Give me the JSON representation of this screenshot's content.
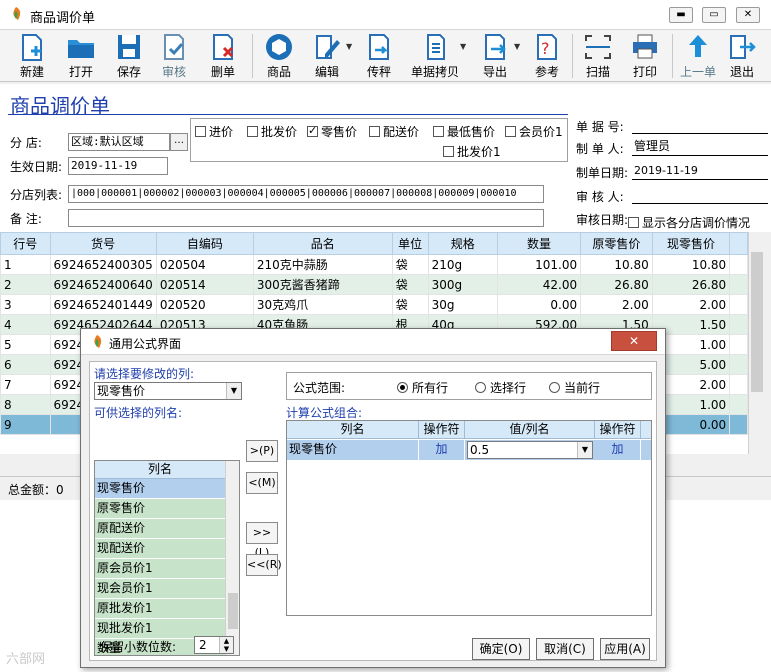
{
  "window": {
    "title": "商品调价单"
  },
  "toolbar": {
    "new": "新建",
    "open": "打开",
    "save": "保存",
    "audit": "审核",
    "delete": "删单",
    "product": "商品",
    "edit": "编辑",
    "transfer": "传秤",
    "copy": "单据拷贝",
    "export": "导出",
    "reference": "参考",
    "scan": "扫描",
    "print": "打印",
    "prev": "上一单",
    "exit": "退出"
  },
  "form": {
    "title": "商品调价单",
    "branch_label": "分      店:",
    "branch_value": "区域:默认区域",
    "effective_label": "生效日期:",
    "effective_value": "2019-11-19",
    "branch_list_label": "分店列表:",
    "branch_list_value": "|000|000001|000002|000003|000004|000005|000006|000007|000008|000009|000010",
    "remark_label": "备      注:",
    "remark_value": "",
    "checks": [
      {
        "label": "进价",
        "checked": false
      },
      {
        "label": "批发价",
        "checked": false
      },
      {
        "label": "零售价",
        "checked": true
      },
      {
        "label": "配送价",
        "checked": false
      },
      {
        "label": "最低售价",
        "checked": false
      },
      {
        "label": "会员价1",
        "checked": false
      },
      {
        "label": "批发价1",
        "checked": false
      }
    ],
    "doc_no_label": "单 据 号:",
    "doc_no_value": "",
    "maker_label": "制 单 人:",
    "maker_value": "管理员",
    "make_date_label": "制单日期:",
    "make_date_value": "2019-11-19",
    "auditor_label": "审 核 人:",
    "auditor_value": "",
    "audit_date_label": "审核日期:",
    "show_branch_label": "显示各分店调价情况"
  },
  "grid": {
    "headers": [
      "行号",
      "货号",
      "自编码",
      "品名",
      "单位",
      "规格",
      "数量",
      "原零售价",
      "现零售价"
    ],
    "rows": [
      [
        "1",
        "6924652400305",
        "020504",
        "210克中蒜肠",
        "袋",
        "210g",
        "101.00",
        "10.80",
        "10.80"
      ],
      [
        "2",
        "6924652400640",
        "020514",
        "300克酱香猪蹄",
        "袋",
        "300g",
        "42.00",
        "26.80",
        "26.80"
      ],
      [
        "3",
        "6924652401449",
        "020520",
        "30克鸡爪",
        "袋",
        "30g",
        "0.00",
        "2.00",
        "2.00"
      ],
      [
        "4",
        "6924652402644",
        "020513",
        "40克鱼肠",
        "根",
        "40g",
        "592.00",
        "1.50",
        "1.50"
      ],
      [
        "5",
        "6924",
        "",
        "",
        "",
        "",
        "",
        "",
        "1.00"
      ],
      [
        "6",
        "6924",
        "",
        "",
        "",
        "",
        "",
        "",
        "5.00"
      ],
      [
        "7",
        "6924",
        "",
        "",
        "",
        "",
        "",
        "",
        "2.00"
      ],
      [
        "8",
        "6924",
        "",
        "",
        "",
        "",
        "",
        "",
        "1.00"
      ],
      [
        "9",
        "",
        "",
        "",
        "",
        "",
        "",
        "",
        "0.00"
      ]
    ]
  },
  "status": {
    "total": "总金额：0"
  },
  "dialog": {
    "title": "通用公式界面",
    "select_col_label": "请选择要修改的列:",
    "select_col_value": "现零售价",
    "available_label": "可供选择的列名:",
    "list_header": "列名",
    "list_items": [
      "现零售价",
      "原零售价",
      "原配送价",
      "现配送价",
      "原会员价1",
      "现会员价1",
      "原批发价1",
      "现批发价1",
      "数量"
    ],
    "btn_add": ">(P)",
    "btn_remove": "<(M)",
    "btn_add_all": ">>(L)",
    "btn_remove_all": "<<(R)",
    "scope_label": "公式范围:",
    "scope_options": [
      "所有行",
      "选择行",
      "当前行"
    ],
    "scope_selected": "所有行",
    "formula_label": "计算公式组合:",
    "formula_headers": [
      "列名",
      "操作符",
      "值/列名",
      "操作符"
    ],
    "formula_row": {
      "col": "现零售价",
      "op": "加",
      "value": "0.5",
      "op2": "加"
    },
    "decimals_label": "保留小数位数:",
    "decimals_value": "2",
    "ok": "确定(O)",
    "cancel": "取消(C)",
    "apply": "应用(A)"
  },
  "watermark": "六部网"
}
